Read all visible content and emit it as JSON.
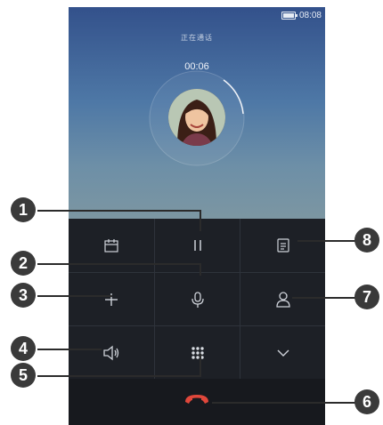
{
  "status": {
    "time": "08:08"
  },
  "call": {
    "caller_label": "正在通话",
    "timer": "00:06"
  },
  "controls": [
    {
      "name": "calendar-button",
      "icon": "calendar-icon"
    },
    {
      "name": "hold-button",
      "icon": "pause-icon"
    },
    {
      "name": "notes-button",
      "icon": "notes-icon"
    },
    {
      "name": "add-call-button",
      "icon": "plus-icon"
    },
    {
      "name": "mute-button",
      "icon": "microphone-icon"
    },
    {
      "name": "contacts-button",
      "icon": "person-icon"
    },
    {
      "name": "speaker-button",
      "icon": "speaker-icon"
    },
    {
      "name": "dialpad-button",
      "icon": "dialpad-icon"
    },
    {
      "name": "collapse-button",
      "icon": "chevron-down-icon"
    }
  ],
  "end_call": {
    "icon": "end-call-icon",
    "color": "#e0473b"
  },
  "callouts": [
    "1",
    "2",
    "3",
    "4",
    "5",
    "6",
    "7",
    "8"
  ]
}
